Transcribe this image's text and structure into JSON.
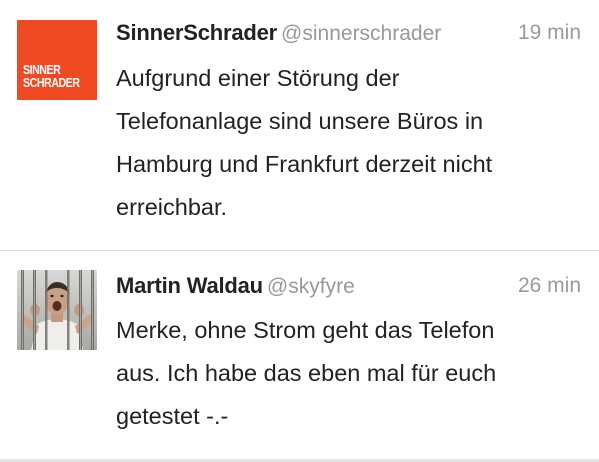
{
  "tweets": [
    {
      "name": "SinnerSchrader",
      "handle": "@sinnerschrader",
      "time": "19 min",
      "text": "Aufgrund einer Störung der\nTelefonanlage sind unsere Büros in\nHamburg und Frankfurt derzeit nicht\nerreichbar.",
      "avatar_logo_text": "SINNER\nSCHRADER",
      "avatar_color": "#f04a25"
    },
    {
      "name": "Martin Waldau",
      "handle": "@skyfyre",
      "time": "26 min",
      "text": "Merke, ohne Strom geht das Telefon\naus. Ich habe das eben mal für euch\ngetestet -.-"
    }
  ]
}
